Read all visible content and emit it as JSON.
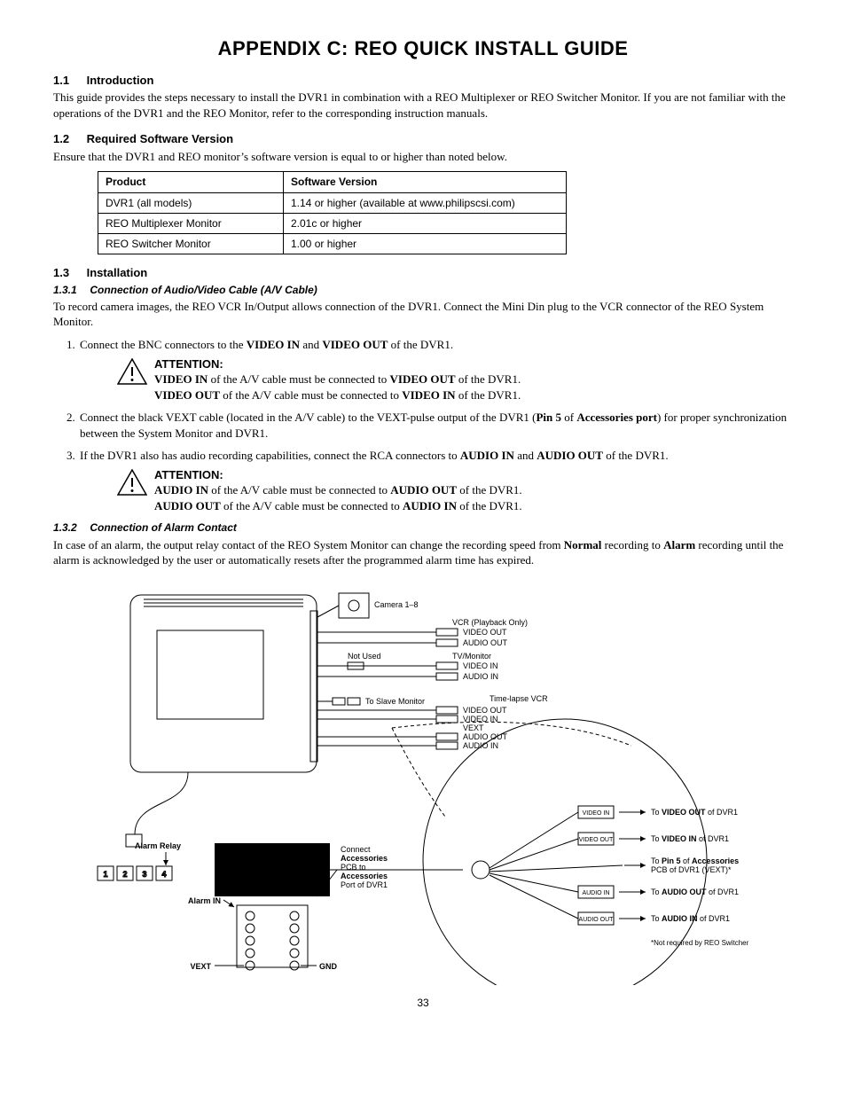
{
  "title": "APPENDIX C: REO QUICK INSTALL GUIDE",
  "s11": {
    "num": "1.1",
    "head": "Introduction",
    "p": "This guide provides the steps necessary to install the DVR1 in combination with a REO Multiplexer or REO Switcher Monitor. If you are not familiar with the operations of the DVR1 and the REO Monitor, refer to the corresponding instruction manuals."
  },
  "s12": {
    "num": "1.2",
    "head": "Required Software Version",
    "p": "Ensure that the DVR1 and REO monitor’s software version is equal to or higher than noted below.",
    "th1": "Product",
    "th2": "Software Version",
    "r1c1": "DVR1 (all models)",
    "r1c2": "1.14 or higher (available at www.philipscsi.com)",
    "r2c1": "REO Multiplexer Monitor",
    "r2c2": "2.01c or higher",
    "r3c1": "REO Switcher Monitor",
    "r3c2": "1.00 or higher"
  },
  "s13": {
    "num": "1.3",
    "head": "Installation"
  },
  "s131": {
    "num": "1.3.1",
    "head": "Connection of Audio/Video Cable (A/V Cable)",
    "p": "To record camera images, the REO VCR In/Output allows connection of the DVR1. Connect the Mini Din plug to the VCR connector of the REO System Monitor."
  },
  "step1": {
    "pre": "Connect the BNC connectors to the ",
    "b1": "VIDEO IN",
    "mid": " and ",
    "b2": "VIDEO OUT",
    "post": " of the DVR1."
  },
  "attn1": {
    "head": "ATTENTION:",
    "l1b1": "VIDEO IN",
    "l1mid": " of the A/V cable must be connected to ",
    "l1b2": "VIDEO OUT",
    "l1end": " of the DVR1.",
    "l2b1": "VIDEO OUT",
    "l2mid": " of the A/V cable must be connected to ",
    "l2b2": "VIDEO IN",
    "l2end": " of the DVR1."
  },
  "step2": {
    "pre": "Connect the black VEXT cable (located in the A/V cable) to the VEXT-pulse output of the DVR1 (",
    "b1": "Pin 5",
    "mid": " of ",
    "b2": "Accessories port",
    "post": ") for proper synchronization between the System Monitor and DVR1."
  },
  "step3": {
    "pre": "If the DVR1 also has audio recording capabilities, connect the RCA connectors to ",
    "b1": "AUDIO IN",
    "mid": " and ",
    "b2": "AUDIO OUT",
    "post": " of the DVR1."
  },
  "attn2": {
    "head": "ATTENTION:",
    "l1b1": "AUDIO IN",
    "l1mid": " of the A/V cable must be connected to ",
    "l1b2": "AUDIO OUT",
    "l1end": " of the DVR1.",
    "l2b1": "AUDIO OUT",
    "l2mid": " of the A/V cable must be connected to ",
    "l2b2": "AUDIO IN",
    "l2end": " of the DVR1."
  },
  "s132": {
    "num": "1.3.2",
    "head": "Connection of Alarm Contact",
    "p_pre": "In case of an alarm, the output relay contact of the REO System Monitor can change the recording speed from ",
    "b1": "Normal",
    "p_mid": " recording to ",
    "b2": "Alarm",
    "p_post": " recording until the alarm is acknowledged by the user or automatically resets after the programmed alarm time has expired."
  },
  "diagram": {
    "camera": "Camera 1–8",
    "vcr_head": "VCR (Playback Only)",
    "vcr_vout": "VIDEO OUT",
    "vcr_aout": "AUDIO OUT",
    "tvm_head": "TV/Monitor",
    "tvm_vin": "VIDEO IN",
    "tvm_ain": "AUDIO IN",
    "not_used": "Not Used",
    "to_slave": "To Slave Monitor",
    "tl_head": "Time-lapse VCR",
    "tl_vout": "VIDEO OUT",
    "tl_vin": "VIDEO IN",
    "tl_vext": "VEXT",
    "tl_aout": "AUDIO OUT",
    "tl_ain": "AUDIO IN",
    "alarm_relay": "Alarm Relay",
    "alarm_in": "Alarm IN",
    "vext": "VEXT",
    "gnd": "GND",
    "box1": "1",
    "box2": "2",
    "box3": "3",
    "box4": "4",
    "acc_l1": "Connect",
    "acc_l2": "Accessories",
    "acc_l3": "PCB to",
    "acc_l4": "Accessories",
    "acc_l5": "Port of DVR1",
    "z_vin": "VIDEO IN",
    "z_vout": "VIDEO OUT",
    "z_ain": "AUDIO IN",
    "z_aout": "AUDIO OUT",
    "to_vout": "VIDEO OUT",
    "to_vout_tail": " of DVR1",
    "to_vout_pre": "To ",
    "to_vin": "VIDEO IN",
    "to_vin_tail": " of DVR1",
    "to_vin_pre": "To ",
    "to_pin5_pre": "To ",
    "to_pin5": "Pin 5",
    "to_pin5_mid": " of ",
    "to_pin5_b2": "Accessories",
    "to_pin5_tail": " PCB of DVR1 (VEXT)*",
    "to_aout": "AUDIO OUT",
    "to_aout_tail": " of DVR1",
    "to_aout_pre": "To ",
    "to_ain": "AUDIO IN",
    "to_ain_tail": " of DVR1",
    "to_ain_pre": "To ",
    "note": "*Not required by REO Switcher"
  },
  "page": "33"
}
